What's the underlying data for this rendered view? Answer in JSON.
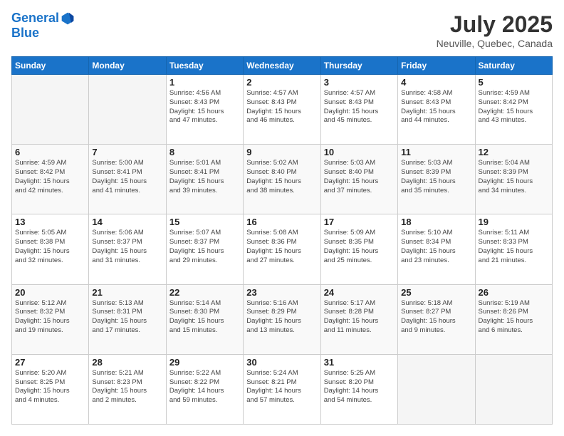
{
  "logo": {
    "line1": "General",
    "line2": "Blue"
  },
  "header": {
    "month": "July 2025",
    "location": "Neuville, Quebec, Canada"
  },
  "weekdays": [
    "Sunday",
    "Monday",
    "Tuesday",
    "Wednesday",
    "Thursday",
    "Friday",
    "Saturday"
  ],
  "weeks": [
    [
      {
        "day": "",
        "detail": ""
      },
      {
        "day": "",
        "detail": ""
      },
      {
        "day": "1",
        "detail": "Sunrise: 4:56 AM\nSunset: 8:43 PM\nDaylight: 15 hours\nand 47 minutes."
      },
      {
        "day": "2",
        "detail": "Sunrise: 4:57 AM\nSunset: 8:43 PM\nDaylight: 15 hours\nand 46 minutes."
      },
      {
        "day": "3",
        "detail": "Sunrise: 4:57 AM\nSunset: 8:43 PM\nDaylight: 15 hours\nand 45 minutes."
      },
      {
        "day": "4",
        "detail": "Sunrise: 4:58 AM\nSunset: 8:43 PM\nDaylight: 15 hours\nand 44 minutes."
      },
      {
        "day": "5",
        "detail": "Sunrise: 4:59 AM\nSunset: 8:42 PM\nDaylight: 15 hours\nand 43 minutes."
      }
    ],
    [
      {
        "day": "6",
        "detail": "Sunrise: 4:59 AM\nSunset: 8:42 PM\nDaylight: 15 hours\nand 42 minutes."
      },
      {
        "day": "7",
        "detail": "Sunrise: 5:00 AM\nSunset: 8:41 PM\nDaylight: 15 hours\nand 41 minutes."
      },
      {
        "day": "8",
        "detail": "Sunrise: 5:01 AM\nSunset: 8:41 PM\nDaylight: 15 hours\nand 39 minutes."
      },
      {
        "day": "9",
        "detail": "Sunrise: 5:02 AM\nSunset: 8:40 PM\nDaylight: 15 hours\nand 38 minutes."
      },
      {
        "day": "10",
        "detail": "Sunrise: 5:03 AM\nSunset: 8:40 PM\nDaylight: 15 hours\nand 37 minutes."
      },
      {
        "day": "11",
        "detail": "Sunrise: 5:03 AM\nSunset: 8:39 PM\nDaylight: 15 hours\nand 35 minutes."
      },
      {
        "day": "12",
        "detail": "Sunrise: 5:04 AM\nSunset: 8:39 PM\nDaylight: 15 hours\nand 34 minutes."
      }
    ],
    [
      {
        "day": "13",
        "detail": "Sunrise: 5:05 AM\nSunset: 8:38 PM\nDaylight: 15 hours\nand 32 minutes."
      },
      {
        "day": "14",
        "detail": "Sunrise: 5:06 AM\nSunset: 8:37 PM\nDaylight: 15 hours\nand 31 minutes."
      },
      {
        "day": "15",
        "detail": "Sunrise: 5:07 AM\nSunset: 8:37 PM\nDaylight: 15 hours\nand 29 minutes."
      },
      {
        "day": "16",
        "detail": "Sunrise: 5:08 AM\nSunset: 8:36 PM\nDaylight: 15 hours\nand 27 minutes."
      },
      {
        "day": "17",
        "detail": "Sunrise: 5:09 AM\nSunset: 8:35 PM\nDaylight: 15 hours\nand 25 minutes."
      },
      {
        "day": "18",
        "detail": "Sunrise: 5:10 AM\nSunset: 8:34 PM\nDaylight: 15 hours\nand 23 minutes."
      },
      {
        "day": "19",
        "detail": "Sunrise: 5:11 AM\nSunset: 8:33 PM\nDaylight: 15 hours\nand 21 minutes."
      }
    ],
    [
      {
        "day": "20",
        "detail": "Sunrise: 5:12 AM\nSunset: 8:32 PM\nDaylight: 15 hours\nand 19 minutes."
      },
      {
        "day": "21",
        "detail": "Sunrise: 5:13 AM\nSunset: 8:31 PM\nDaylight: 15 hours\nand 17 minutes."
      },
      {
        "day": "22",
        "detail": "Sunrise: 5:14 AM\nSunset: 8:30 PM\nDaylight: 15 hours\nand 15 minutes."
      },
      {
        "day": "23",
        "detail": "Sunrise: 5:16 AM\nSunset: 8:29 PM\nDaylight: 15 hours\nand 13 minutes."
      },
      {
        "day": "24",
        "detail": "Sunrise: 5:17 AM\nSunset: 8:28 PM\nDaylight: 15 hours\nand 11 minutes."
      },
      {
        "day": "25",
        "detail": "Sunrise: 5:18 AM\nSunset: 8:27 PM\nDaylight: 15 hours\nand 9 minutes."
      },
      {
        "day": "26",
        "detail": "Sunrise: 5:19 AM\nSunset: 8:26 PM\nDaylight: 15 hours\nand 6 minutes."
      }
    ],
    [
      {
        "day": "27",
        "detail": "Sunrise: 5:20 AM\nSunset: 8:25 PM\nDaylight: 15 hours\nand 4 minutes."
      },
      {
        "day": "28",
        "detail": "Sunrise: 5:21 AM\nSunset: 8:23 PM\nDaylight: 15 hours\nand 2 minutes."
      },
      {
        "day": "29",
        "detail": "Sunrise: 5:22 AM\nSunset: 8:22 PM\nDaylight: 14 hours\nand 59 minutes."
      },
      {
        "day": "30",
        "detail": "Sunrise: 5:24 AM\nSunset: 8:21 PM\nDaylight: 14 hours\nand 57 minutes."
      },
      {
        "day": "31",
        "detail": "Sunrise: 5:25 AM\nSunset: 8:20 PM\nDaylight: 14 hours\nand 54 minutes."
      },
      {
        "day": "",
        "detail": ""
      },
      {
        "day": "",
        "detail": ""
      }
    ]
  ]
}
